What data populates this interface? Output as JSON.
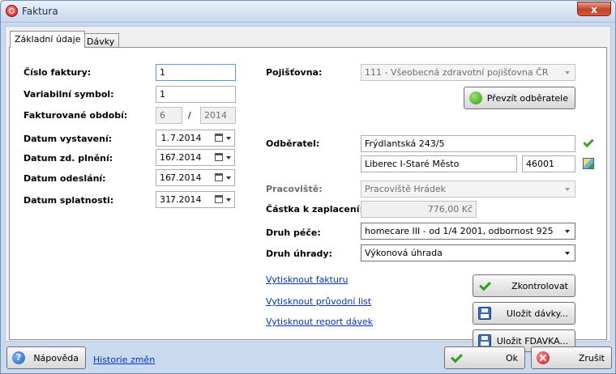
{
  "window": {
    "title": "Faktura",
    "close_glyph": "x"
  },
  "tabs": [
    {
      "label": "Základní údaje"
    },
    {
      "label": "Dávky"
    }
  ],
  "left": {
    "invoice_number": {
      "label": "Číslo faktury:",
      "value": "1"
    },
    "variable_symbol": {
      "label": "Variabilní symbol:",
      "value": "1"
    },
    "period": {
      "label": "Fakturované období:",
      "month": "6",
      "separator": "/",
      "year": "2014"
    },
    "issue_date": {
      "label": "Datum vystavení:",
      "day": "1.",
      "rest": "7.2014"
    },
    "supply_date": {
      "label": "Datum zd. plnění:",
      "day": "16.",
      "rest": "7.2014"
    },
    "sent_date": {
      "label": "Datum odeslání:",
      "day": "16.",
      "rest": "7.2014"
    },
    "due_date": {
      "label": "Datum splatnosti:",
      "day": "31.",
      "rest": "7.2014"
    }
  },
  "right": {
    "insurer": {
      "label": "Pojišťovna:",
      "value": "111 - Všeobecná zdravotní pojišťovna ČR"
    },
    "take_customer_button": "Převzít odběratele",
    "customer": {
      "label": "Odběratel:",
      "street": "Frýdlantská 243/5",
      "city": "Liberec I-Staré Město",
      "zip": "46001"
    },
    "workplace": {
      "label": "Pracoviště:",
      "value": "Pracoviště Hrádek"
    },
    "amount": {
      "label": "Částka k zaplacení:",
      "value": "776,00 Kč"
    },
    "care_type": {
      "label": "Druh péče:",
      "value": "homecare III - od 1/4 2001, odbornost 925"
    },
    "payment_type": {
      "label": "Druh úhrady:",
      "value": "Výkonová úhrada"
    }
  },
  "links": {
    "print_invoice": "Vytisknout fakturu",
    "print_cover": "Vytisknout průvodní list",
    "print_report": "Vytisknout report dávek",
    "history": "Historie změn"
  },
  "actions": {
    "check": "Zkontrolovat",
    "save_batches": "Uložit dávky...",
    "save_fdavka": "Uložit FDAVKA..."
  },
  "footer": {
    "help": "Nápověda",
    "ok": "Ok",
    "cancel": "Zrušit"
  }
}
